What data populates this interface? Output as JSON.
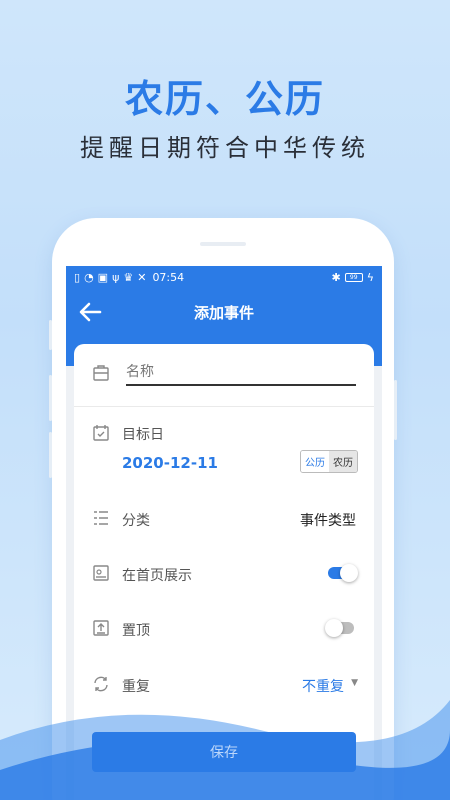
{
  "promo": {
    "headline": "农历、公历",
    "subline": "提醒日期符合中华传统"
  },
  "status_bar": {
    "time": "07:54",
    "battery": "99"
  },
  "appbar": {
    "title": "添加事件"
  },
  "form": {
    "name_placeholder": "名称",
    "target_date_label": "目标日",
    "target_date_value": "2020-12-11",
    "calendar_solar": "公历",
    "calendar_lunar": "农历",
    "category_label": "分类",
    "category_value": "事件类型",
    "show_home_label": "在首页展示",
    "show_home_on": true,
    "pin_label": "置顶",
    "pin_on": false,
    "repeat_label": "重复",
    "repeat_value": "不重复"
  },
  "save_label": "保存",
  "colors": {
    "accent": "#2b7be6",
    "background": "#c8e1fa"
  }
}
